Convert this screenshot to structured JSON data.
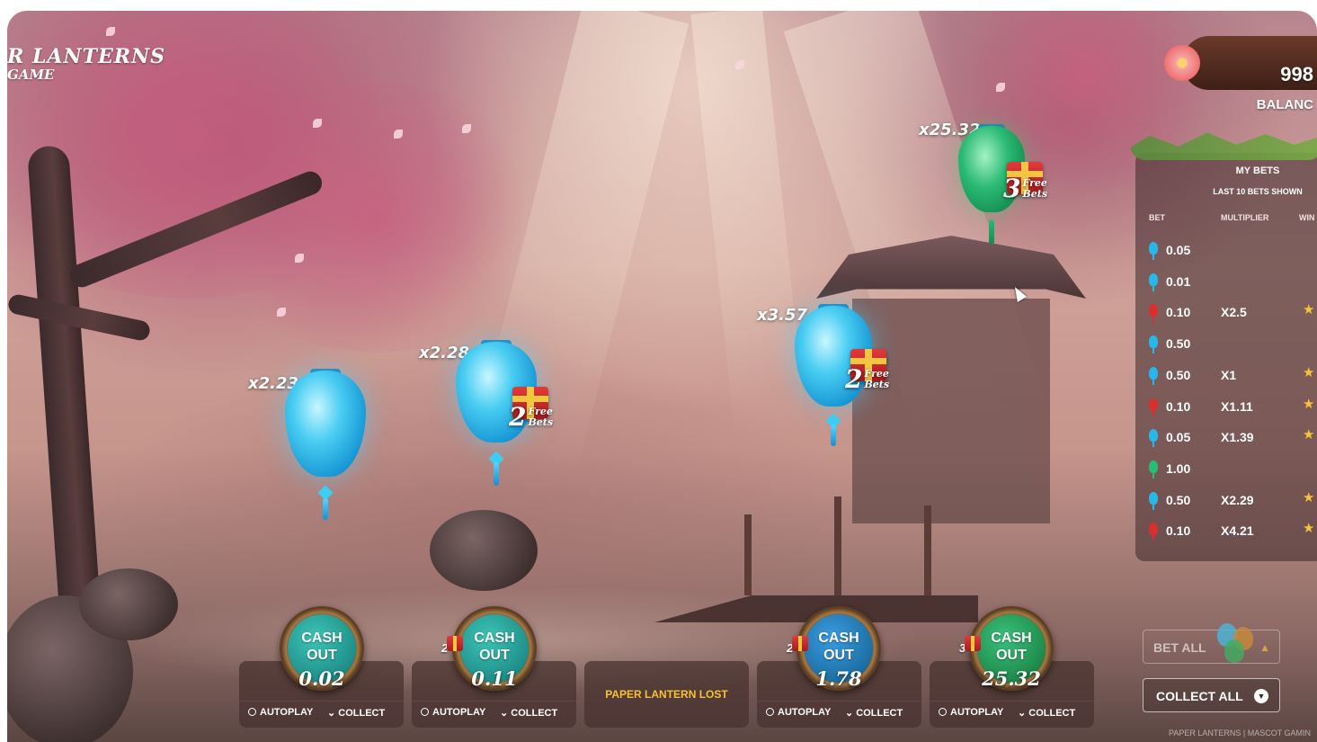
{
  "game": {
    "logo_line1": "R LANTERNS",
    "logo_line2": "GAME"
  },
  "balance": {
    "amount": "998",
    "label": "BALANC"
  },
  "my_bets": {
    "title": "MY BETS",
    "subtitle": "LAST 10 BETS SHOWN",
    "columns": [
      "BET",
      "MULTIPLIER",
      "WIN"
    ],
    "rows": [
      {
        "bet": "0.05",
        "multiplier": "",
        "color": "#27b7ea",
        "win": false
      },
      {
        "bet": "0.01",
        "multiplier": "",
        "color": "#27b7ea",
        "win": false
      },
      {
        "bet": "0.10",
        "multiplier": "X2.5",
        "color": "#d9302f",
        "win": true
      },
      {
        "bet": "0.50",
        "multiplier": "",
        "color": "#27b7ea",
        "win": false
      },
      {
        "bet": "0.50",
        "multiplier": "X1",
        "color": "#27b7ea",
        "win": true
      },
      {
        "bet": "0.10",
        "multiplier": "X1.11",
        "color": "#d9302f",
        "win": true
      },
      {
        "bet": "0.05",
        "multiplier": "X1.39",
        "color": "#27b7ea",
        "win": true
      },
      {
        "bet": "1.00",
        "multiplier": "",
        "color": "#2bbb74",
        "win": false
      },
      {
        "bet": "0.50",
        "multiplier": "X2.29",
        "color": "#27b7ea",
        "win": true
      },
      {
        "bet": "0.10",
        "multiplier": "X4.21",
        "color": "#d9302f",
        "win": true
      }
    ]
  },
  "lanterns": [
    {
      "multiplier": "x2.23"
    },
    {
      "multiplier": "x2.28",
      "free_bets": "2",
      "free_label": "Free Bets"
    },
    {
      "multiplier": "x3.57",
      "free_bets": "2",
      "free_label": "Free Bets"
    },
    {
      "multiplier": "x25.32",
      "free_bets": "3",
      "free_label": "Free Bets"
    }
  ],
  "slots": [
    {
      "cash_label": "CASH OUT",
      "amount": "0.02",
      "autoplay": "AUTOPLAY",
      "collect": "COLLECT",
      "color": "#1f8f8a"
    },
    {
      "cash_label": "CASH OUT",
      "amount": "0.11",
      "autoplay": "AUTOPLAY",
      "collect": "COLLECT",
      "color": "#1f8f8a",
      "free_bets": "2"
    },
    {
      "lost": "PAPER LANTERN LOST"
    },
    {
      "cash_label": "CASH OUT",
      "amount": "1.78",
      "autoplay": "AUTOPLAY",
      "collect": "COLLECT",
      "color": "#1d6fa3",
      "free_bets": "2"
    },
    {
      "cash_label": "CASH OUT",
      "amount": "25.32",
      "autoplay": "AUTOPLAY",
      "collect": "COLLECT",
      "color": "#1f8a4c",
      "free_bets": "3"
    }
  ],
  "controls": {
    "bet_all": "BET ALL",
    "collect_all": "COLLECT ALL"
  },
  "footer": "PAPER LANTERNS | MASCOT GAMIN"
}
